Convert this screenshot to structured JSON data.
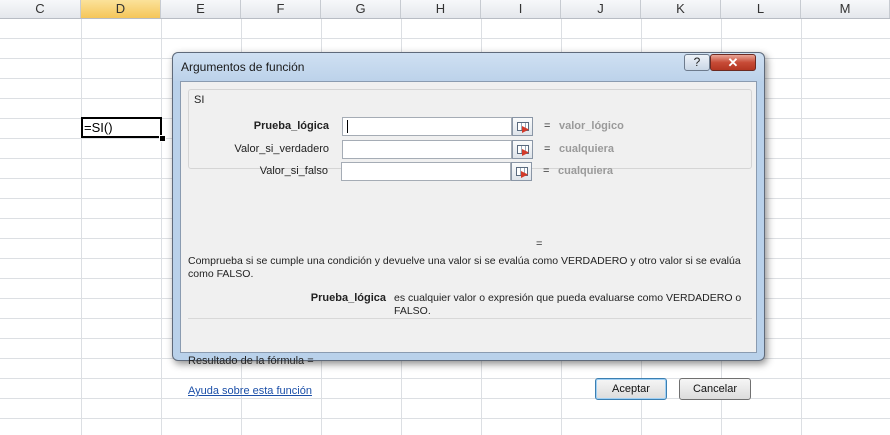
{
  "spreadsheet": {
    "columns": [
      "C",
      "D",
      "E",
      "F",
      "G",
      "H",
      "I",
      "J",
      "K",
      "L",
      "M"
    ],
    "selected_column": "D",
    "active_cell_value": "=SI()"
  },
  "dialog": {
    "title": "Argumentos de función",
    "help_button": "?",
    "close_button": "✕",
    "function_name": "SI",
    "arguments": [
      {
        "label": "Prueba_lógica",
        "bold": true,
        "value": "",
        "result": "valor_lógico"
      },
      {
        "label": "Valor_si_verdadero",
        "bold": false,
        "value": "",
        "result": "cualquiera"
      },
      {
        "label": "Valor_si_falso",
        "bold": false,
        "value": "",
        "result": "cualquiera"
      }
    ],
    "equals": "=",
    "description": "Comprueba si se cumple una condición y devuelve una valor si se evalúa como VERDADERO y otro valor si se evalúa como FALSO.",
    "current_arg_name": "Prueba_lógica",
    "current_arg_description": "es cualquier valor o expresión que pueda evaluarse como VERDADERO o FALSO.",
    "formula_result": "Resultado de la fórmula =",
    "help_link": "Ayuda sobre esta función",
    "ok_label": "Aceptar",
    "cancel_label": "Cancelar"
  }
}
